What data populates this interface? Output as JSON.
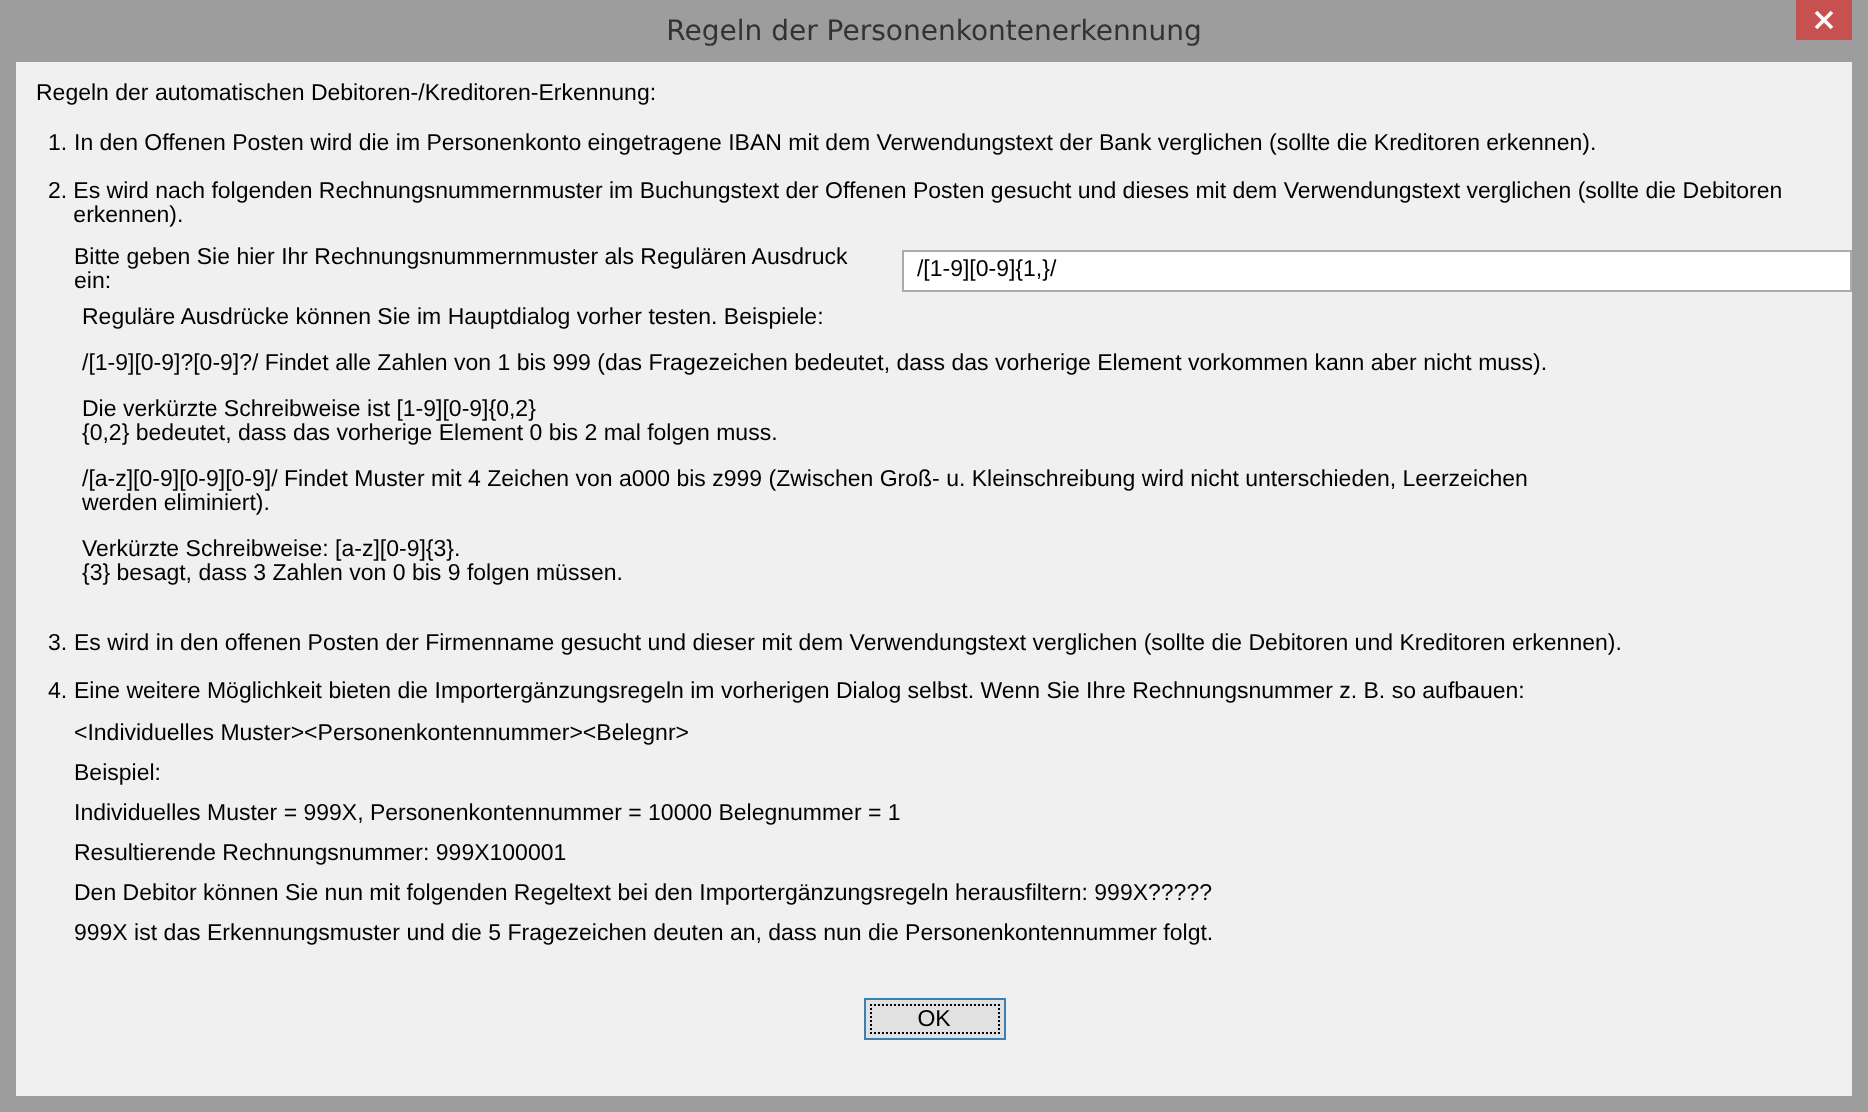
{
  "window": {
    "title": "Regeln der Personenkontenerkennung"
  },
  "heading": "Regeln der automatischen Debitoren-/Kreditoren-Erkennung:",
  "rules": [
    {
      "number": "1.",
      "text": "In den Offenen Posten wird die im Personenkonto eingetragene IBAN mit dem Verwendungstext der Bank verglichen (sollte die Kreditoren erkennen)."
    },
    {
      "number": "2.",
      "text": "Es wird nach folgenden Rechnungsnummernmuster im Buchungstext der Offenen Posten gesucht und dieses mit dem Verwendungstext verglichen (sollte die Debitoren erkennen).",
      "details": [
        {
          "kind": "field",
          "label": "Bitte geben Sie hier Ihr Rechnungsnummernmuster als Regulären Ausdruck ein:",
          "value": "/[1-9][0-9]{1,}/"
        },
        {
          "kind": "paragraph",
          "lines": [
            "Reguläre Ausdrücke können Sie im Hauptdialog vorher testen.  Beispiele:"
          ]
        },
        {
          "kind": "paragraph",
          "lines": [
            "/[1-9][0-9]?[0-9]?/ Findet alle Zahlen von 1 bis 999 (das Fragezeichen bedeutet, dass das vorherige Element vorkommen kann aber nicht muss)."
          ]
        },
        {
          "kind": "paragraph",
          "lines": [
            "Die verkürzte Schreibweise ist [1-9][0-9]{0,2}",
            "{0,2} bedeutet, dass das vorherige Element 0 bis 2 mal folgen muss."
          ]
        },
        {
          "kind": "paragraph",
          "lines": [
            "/[a-z][0-9][0-9][0-9]/ Findet Muster mit 4 Zeichen von a000 bis z999 (Zwischen Groß- u. Kleinschreibung wird nicht unterschieden, Leerzeichen",
            "werden eliminiert)."
          ]
        },
        {
          "kind": "paragraph",
          "lines": [
            "Verkürzte Schreibweise: [a-z][0-9]{3}.",
            "{3} besagt, dass 3 Zahlen von 0 bis 9 folgen müssen."
          ]
        }
      ]
    },
    {
      "number": "3.",
      "text": "Es wird in den offenen Posten der Firmenname gesucht und dieser mit dem Verwendungstext verglichen (sollte die Debitoren und Kreditoren erkennen)."
    },
    {
      "number": "4.",
      "text": "Eine weitere Möglichkeit bieten die Importergänzungsregeln im vorherigen Dialog selbst. Wenn Sie Ihre Rechnungsnummer z. B. so aufbauen:",
      "details": [
        {
          "kind": "line",
          "text": "<Individuelles Muster><Personenkontennummer><Belegnr>"
        },
        {
          "kind": "line",
          "text": "Beispiel:"
        },
        {
          "kind": "line",
          "text": "Individuelles Muster = 999X, Personenkontennummer = 10000 Belegnummer = 1"
        },
        {
          "kind": "line",
          "text": "Resultierende Rechnungsnummer: 999X100001"
        },
        {
          "kind": "line",
          "text": "Den Debitor können Sie nun mit folgenden Regeltext bei den Importergänzungsregeln herausfiltern: 999X?????"
        },
        {
          "kind": "line",
          "text": "999X ist das Erkennungsmuster und die 5 Fragezeichen deuten an, dass nun die Personenkontennummer folgt."
        }
      ]
    }
  ],
  "buttons": [
    {
      "label": "OK",
      "focused": true
    }
  ]
}
